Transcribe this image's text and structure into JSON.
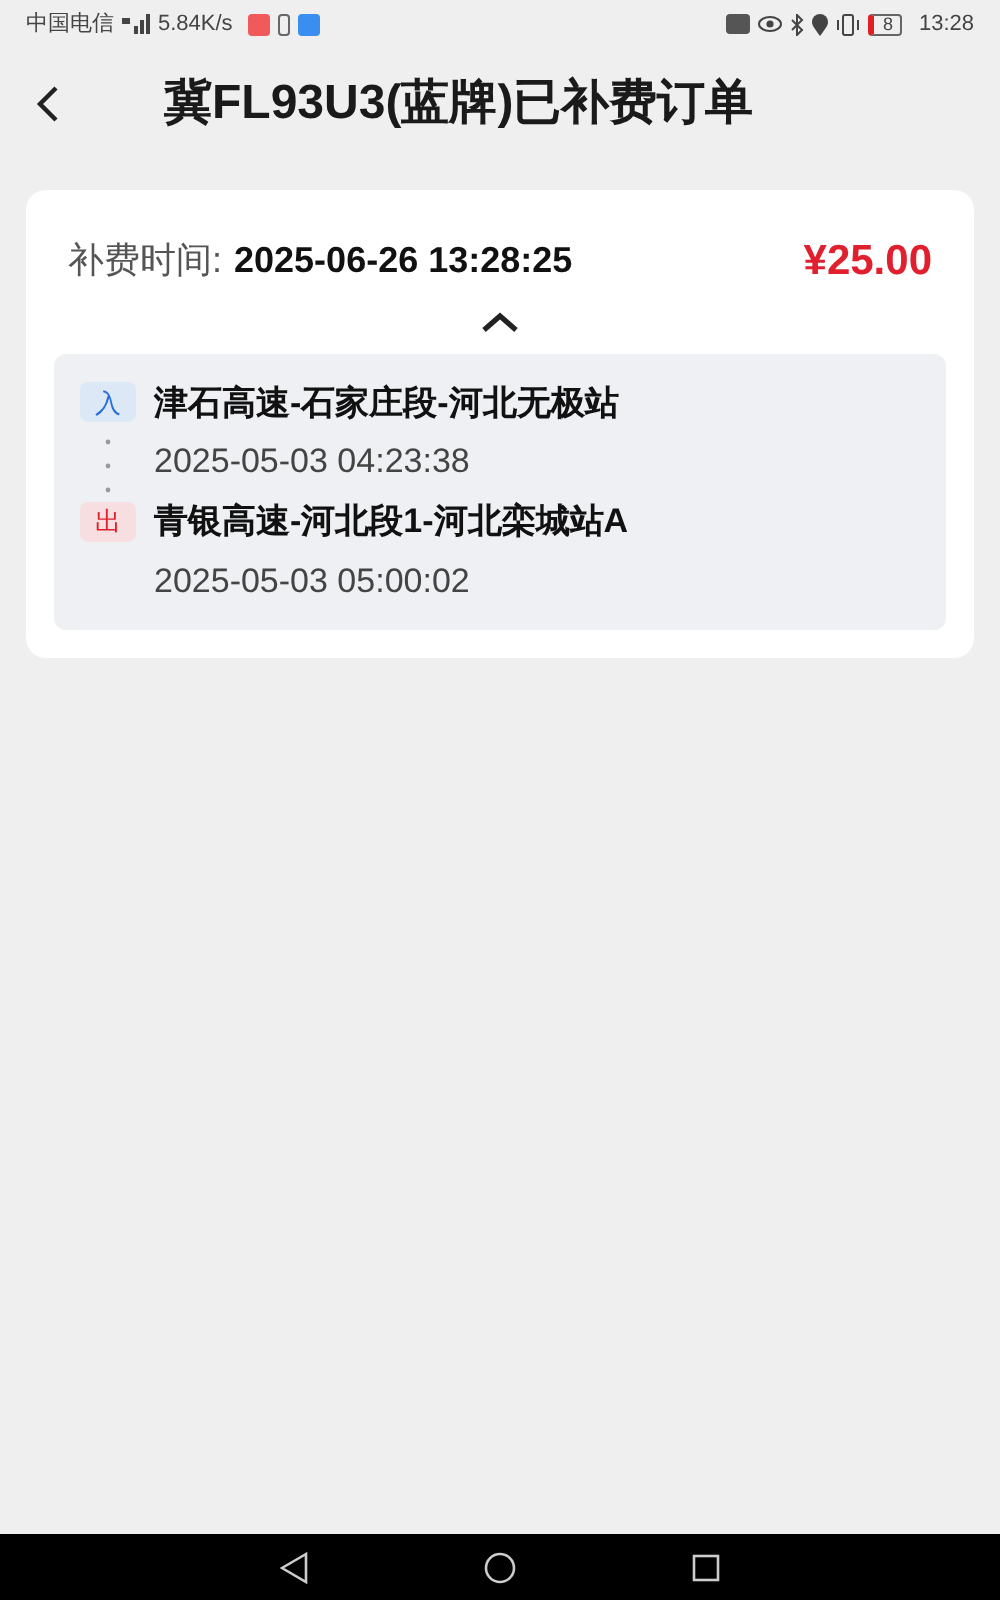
{
  "status_bar": {
    "carrier": "中国电信",
    "speed": "5.84K/s",
    "battery": "8",
    "time": "13:28"
  },
  "header": {
    "title": "冀FL93U3(蓝牌)已补费订单"
  },
  "order": {
    "time_label": "补费时间:",
    "time": "2025-06-26 13:28:25",
    "amount": "¥25.00",
    "expanded": true,
    "stops": [
      {
        "kind": "entry",
        "tag": "入",
        "station": "津石高速-石家庄段-河北无极站",
        "time": "2025-05-03 04:23:38"
      },
      {
        "kind": "exit",
        "tag": "出",
        "station": "青银高速-河北段1-河北栾城站A",
        "time": "2025-05-03 05:00:02"
      }
    ]
  }
}
